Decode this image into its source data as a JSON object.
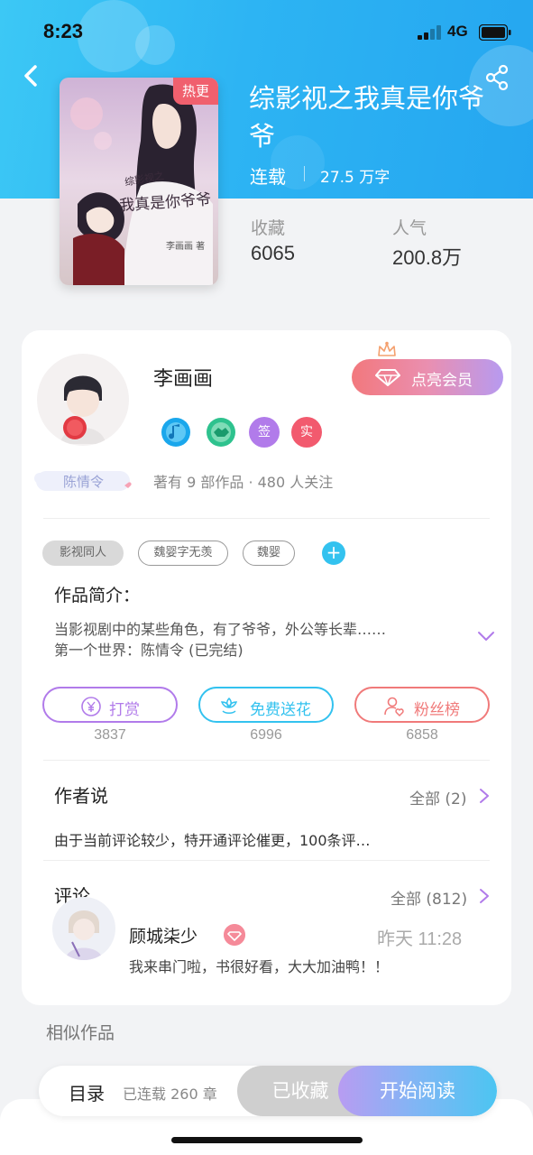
{
  "status_bar": {
    "time": "8:23",
    "network": "4G"
  },
  "book": {
    "badge": "热更",
    "title": "综影视之我真是你爷爷",
    "cover_text_top": "综影视之",
    "cover_text_main": "我真是你爷爷",
    "cover_text_author": "李画画 著",
    "status": "连载",
    "word_count": "27.5 万字",
    "stats": [
      {
        "label": "收藏",
        "value": "6065"
      },
      {
        "label": "人气",
        "value": "200.8万"
      }
    ]
  },
  "author": {
    "name": "李画画",
    "role_badge": "陈情令",
    "vip_button": "点亮会员",
    "badges": [
      {
        "icon": "note-medal-icon",
        "color": "#1aa7ec"
      },
      {
        "icon": "handshake-medal-icon",
        "color": "#2ec28e"
      },
      {
        "text": "签",
        "color": "#b17bea"
      },
      {
        "text": "实",
        "color": "#f25a6e"
      }
    ],
    "summary": "著有 9 部作品 · 480 人关注"
  },
  "tags": [
    "影视同人",
    "魏婴字无羡",
    "魏婴"
  ],
  "intro": {
    "title": "作品简介：",
    "line1": "当影视剧中的某些角色，有了爷爷，外公等长辈……",
    "line2": "第一个世界：陈情令 (已完结)"
  },
  "actions": [
    {
      "label": "打赏",
      "count": "3837",
      "color": "#b17bea",
      "icon": "yen-coin-icon"
    },
    {
      "label": "免费送花",
      "count": "6996",
      "color": "#33c2ef",
      "icon": "flower-icon"
    },
    {
      "label": "粉丝榜",
      "count": "6858",
      "color": "#f07a7a",
      "icon": "fan-user-icon"
    }
  ],
  "author_says": {
    "title": "作者说",
    "more": "全部 (2)",
    "text": "由于当前评论较少，特开通评论催更，100条评…"
  },
  "comments": {
    "title": "评论",
    "more": "全部 (812)",
    "items": [
      {
        "user": "顾城柒少",
        "time": "昨天 11:28",
        "text": "我来串门啦，书很好看，大大加油鸭！！"
      }
    ]
  },
  "similar": {
    "title": "相似作品"
  },
  "bottom_bar": {
    "toc": "目录",
    "chapter_count": "已连载 260 章",
    "collect": "已收藏",
    "read": "开始阅读"
  },
  "colors": {
    "header_blue": "#2db4f3",
    "accent_cyan": "#33c2ef",
    "accent_purple": "#b17bea",
    "accent_red": "#f07a7a"
  }
}
